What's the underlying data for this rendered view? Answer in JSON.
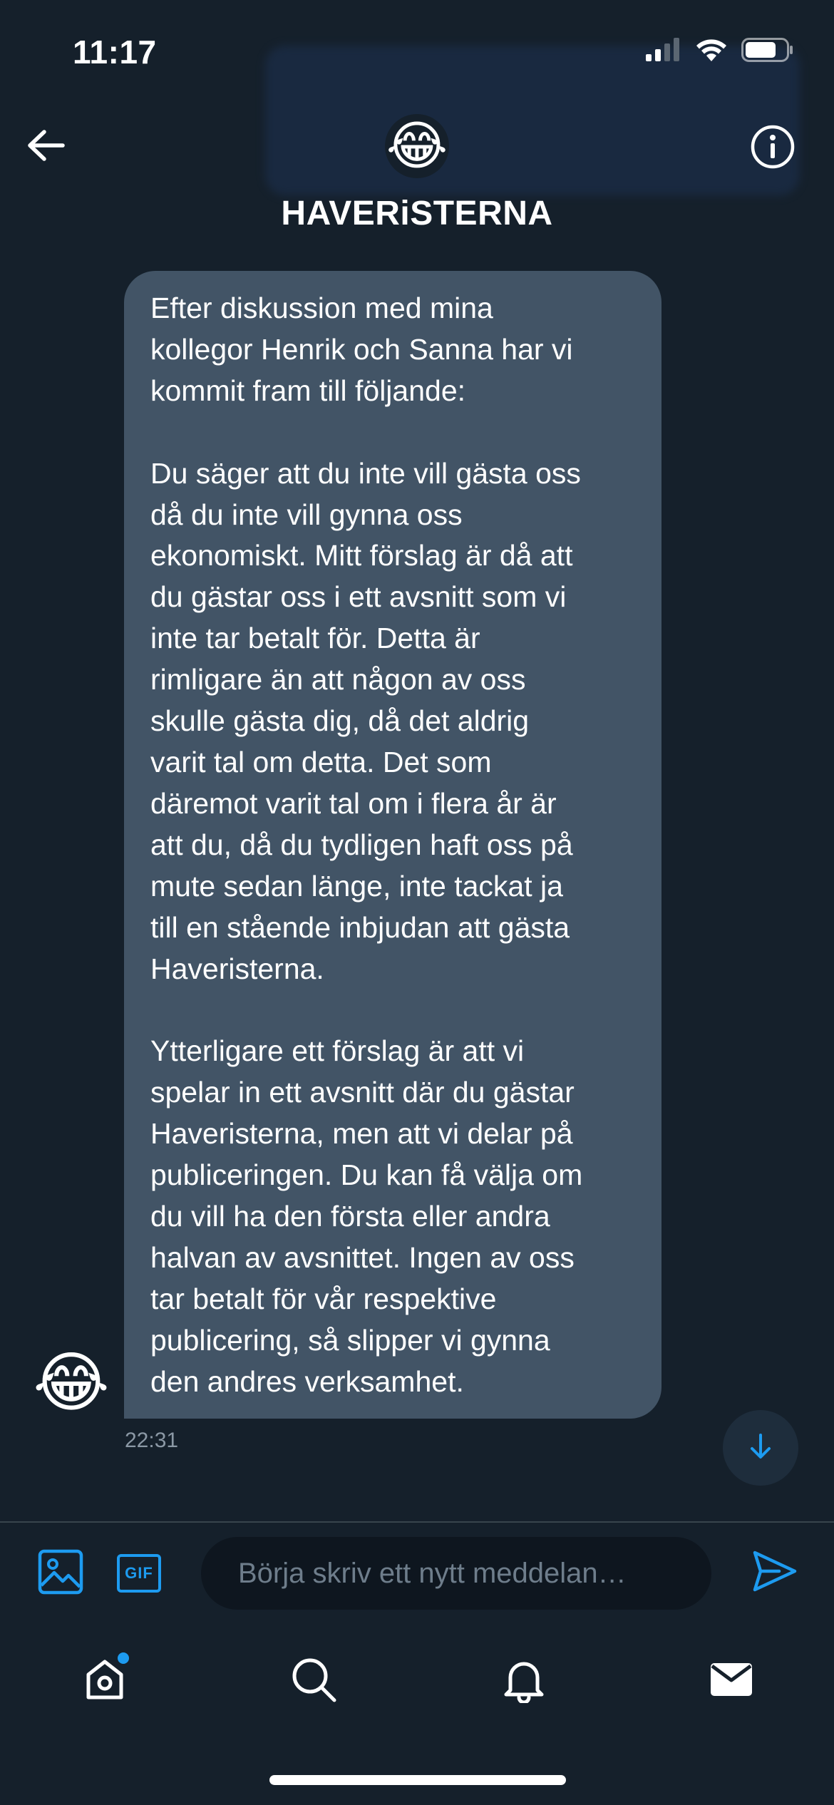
{
  "status_bar": {
    "time": "11:17"
  },
  "header": {
    "back_icon": "arrow-left-icon",
    "avatar_emoji": "😂",
    "title": "HAVERiSTERNA",
    "info_icon": "info-circle-icon"
  },
  "message": {
    "sender_avatar_emoji": "😂",
    "text": "Efter diskussion med mina\nkollegor Henrik och Sanna har vi\nkommit fram till följande:\n\nDu säger att du inte vill gästa oss\ndå du inte vill gynna oss\nekonomiskt. Mitt förslag är då att\ndu gästar oss i ett avsnitt som vi\ninte tar betalt för. Detta är\nrimligare än att någon av oss\nskulle gästa dig, då det aldrig\nvarit tal om detta. Det som\ndäremot varit tal om i flera år är\natt du, då du tydligen haft oss på\nmute sedan länge, inte tackat ja\ntill en stående inbjudan att gästa\nHaveristerna.\n\nYtterligare ett förslag är att vi\nspelar in ett avsnitt där du gästar\nHaveristerna, men att vi delar på\npubliceringen. Du kan få välja om\ndu vill ha den första eller andra\nhalvan av avsnittet. Ingen av oss\ntar betalt för vår respektive\npublicering, så slipper vi gynna\nden andres verksamhet.",
    "timestamp": "22:31"
  },
  "composer": {
    "placeholder": "Börja skriv ett nytt meddelan…",
    "value": "",
    "gif_label": "GIF",
    "image_icon": "image-icon",
    "send_icon": "send-icon"
  },
  "tabs": [
    {
      "name": "home",
      "icon": "home-icon",
      "has_notification_dot": true
    },
    {
      "name": "search",
      "icon": "search-icon",
      "has_notification_dot": false
    },
    {
      "name": "notifications",
      "icon": "bell-icon",
      "has_notification_dot": false
    },
    {
      "name": "messages",
      "icon": "mail-icon",
      "has_notification_dot": false
    }
  ],
  "colors": {
    "background": "#15202b",
    "bubble": "#425466",
    "accent": "#1d9bf0",
    "muted_text": "#8b98a5"
  }
}
